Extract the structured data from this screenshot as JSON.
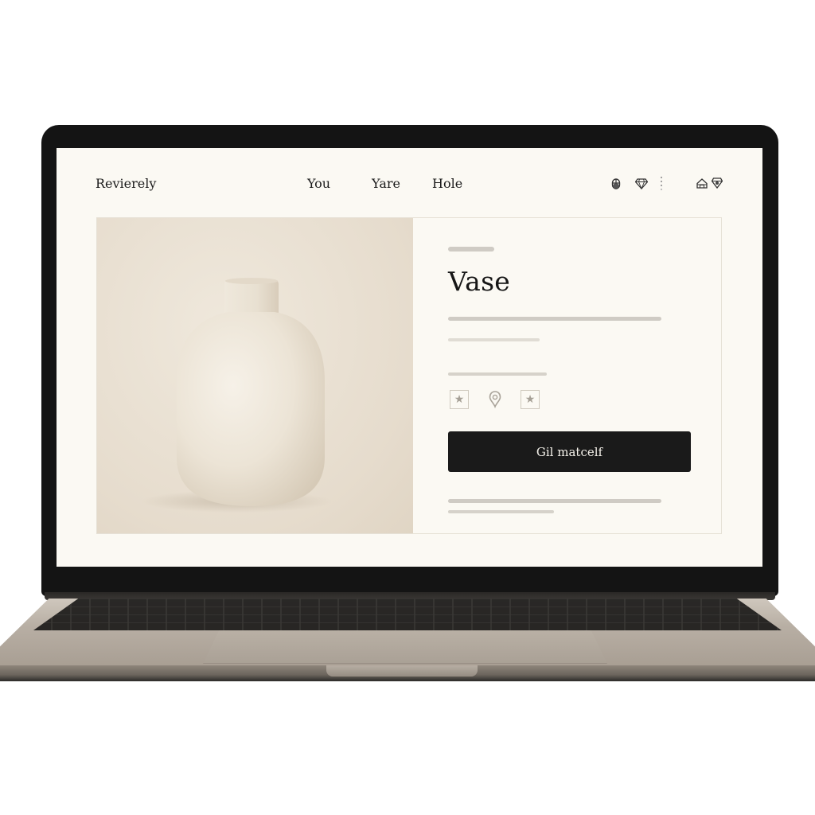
{
  "header": {
    "brand": "Revierely",
    "nav": [
      {
        "label": "You"
      },
      {
        "label": "Yare"
      },
      {
        "label": "Hole"
      }
    ],
    "icons": [
      "mouse-icon",
      "diamond-icon",
      "more-vertical-icon",
      "home-icon",
      "diamond-icon"
    ]
  },
  "product": {
    "image_subject": "vase-image",
    "title": "Vase",
    "options": [
      {
        "icon": "star-icon",
        "glyph": "★"
      },
      {
        "icon": "pin-icon",
        "glyph": ""
      },
      {
        "icon": "star-icon",
        "glyph": "★"
      }
    ],
    "cta_label": "Gil matcelf"
  },
  "colors": {
    "screen_bg": "#fbf9f3",
    "image_bg": "#e6dccd",
    "vase": "#ece4d6",
    "button_bg": "#1a1a1a",
    "button_text": "#f4f1ea",
    "placeholder_bar": "#cfcbc4"
  }
}
